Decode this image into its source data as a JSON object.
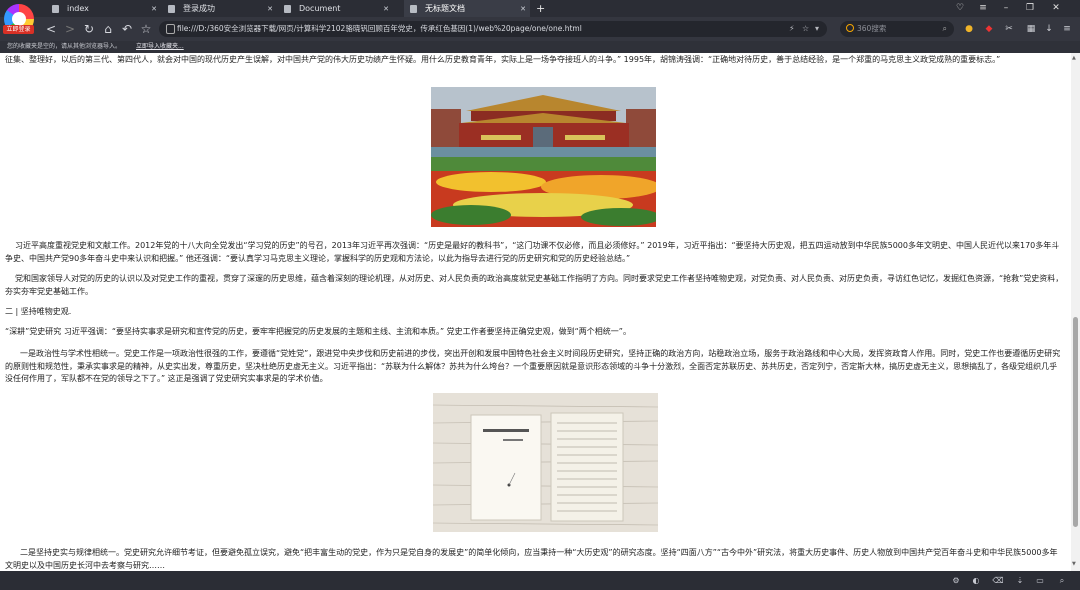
{
  "tabs": [
    {
      "label": "index",
      "active": false
    },
    {
      "label": "登录成功",
      "active": false
    },
    {
      "label": "Document",
      "active": false
    },
    {
      "label": "无标题文档",
      "active": true
    }
  ],
  "login_badge": "立即登录",
  "url": "file:///D:/360安全浏览器下载/网页/计算科学2102骆晓钒回顾百年党史，传承红色基因(1)/web%20page/one/one.html",
  "search_placeholder": "360搜索",
  "bookmarks": {
    "notice": "您的收藏夹是空的，请从其他浏览器导入。",
    "import_link": "立即导入收藏夹..."
  },
  "paragraphs": {
    "p0": "征集、整理好，以后的第三代、第四代人，就会对中国的现代历史产生误解，对中国共产党的伟大历史功绩产生怀疑。用什么历史教育青年，实际上是一场争夺接班人的斗争。” 1995年，胡锦涛强调：“正确地对待历史，善于总结经验，是一个郑重的马克思主义政党成熟的重要标志。”",
    "p1": "习近平高度重视党史和文献工作。2012年党的十八大向全党发出“学习党的历史”的号召，2013年习近平再次强调：“历史是最好的教科书”，“这门功课不仅必修，而且必须修好。” 2019年，习近平指出：“要坚持大历史观，把五四运动放到中华民族5000多年文明史、中国人民近代以来170多年斗争史、中国共产党90多年奋斗史中来认识和把握。” 他还强调：“要认真学习马克思主义理论，掌握科学的历史观和方法论，以此为指导去进行党的历史研究和党的历史经验总结。”",
    "p2": "党和国家领导人对党的历史的认识以及对党史工作的重视，贯穿了深邃的历史思维，蕴含着深刻的理论机理，从对历史、对人民负责的政治高度就党史基础工作指明了方向。同时要求党史工作者坚持唯物史观，对党负责、对人民负责、对历史负责，寻访红色记忆，发掘红色资源，“抢救”党史资料，夯实夯牢党史基础工作。",
    "h2": "二 | 坚持唯物史观.",
    "p3": "“深耕”党史研究 习近平强调：“要坚持实事求是研究和宣传党的历史，要牢牢把握党的历史发展的主题和主线、主流和本质。” 党史工作者要坚持正确党史观，做到“两个相统一”。",
    "p4": "一是政治性与学术性相统一。党史工作是一项政治性很强的工作，要遵循“党姓党”，跟进党中央步伐和历史前进的步伐，突出开创和发展中国特色社会主义时间段历史研究，坚持正确的政治方向，站稳政治立场，服务于政治路线和中心大局，发挥资政育人作用。同时，党史工作也要遵循历史研究的原则性和规范性，秉承实事求是的精神，从史实出发，尊重历史，坚决杜绝历史虚无主义。习近平指出：“苏联为什么解体？苏共为什么垮台？一个重要原因就是意识形态领域的斗争十分激烈，全面否定苏联历史、苏共历史，否定列宁，否定斯大林，搞历史虚无主义，思想搞乱了，各级党组织几乎没任何作用了，军队都不在党的领导之下了。” 这正是强调了党史研究实事求是的学术价值。",
    "p5": "二是坚持史实与规律相统一。党史研究允许细节考证，但要避免孤立误究，避免“把丰富生动的党史，作为只是党自身的发展史”的简单化倾向，应当秉持一种“大历史观”的研究态度。坚持“四面八方”“古今中外”研究法，将重大历史事件、历史人物放到中国共产党百年奋斗史和中华民族5000多年文明史以及中国历史长河中去考察与研究……"
  },
  "images": {
    "img1": "tiananmen-photo",
    "img2": "manuscript-photo"
  }
}
